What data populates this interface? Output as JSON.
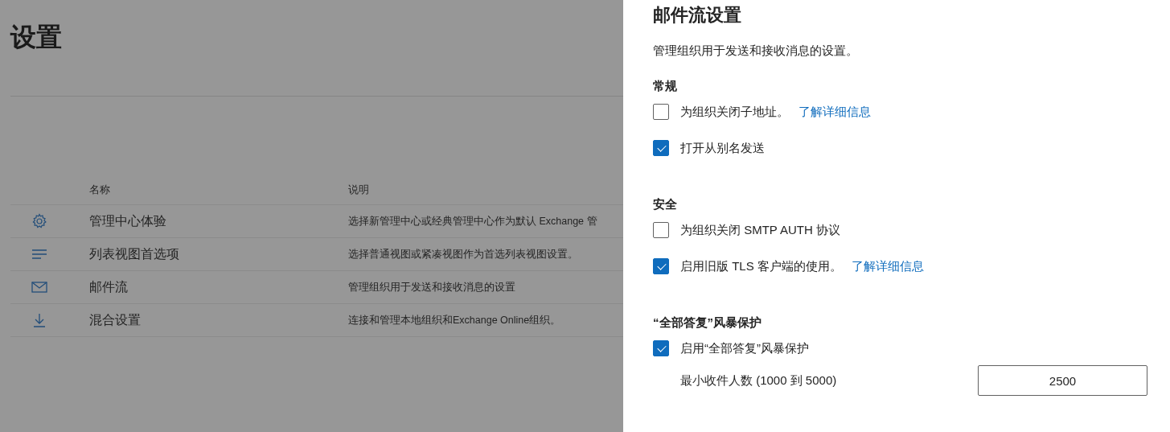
{
  "page": {
    "title": "设置",
    "table": {
      "columns": [
        "名称",
        "说明"
      ],
      "rows": [
        {
          "kind": "gear",
          "name": "管理中心体验",
          "description": "选择新管理中心或经典管理中心作为默认 Exchange 管"
        },
        {
          "kind": "list",
          "name": "列表视图首选项",
          "description": "选择普通视图或紧凑视图作为首选列表视图设置。"
        },
        {
          "kind": "mail",
          "name": "邮件流",
          "description": "管理组织用于发送和接收消息的设置"
        },
        {
          "kind": "download",
          "name": "混合设置",
          "description": "连接和管理本地组织和Exchange Online组织。"
        }
      ]
    }
  },
  "panel": {
    "title": "邮件流设置",
    "description": "管理组织用于发送和接收消息的设置。",
    "sections": [
      {
        "heading": "常规",
        "options": [
          {
            "label": "为组织关闭子地址。",
            "link": "了解详细信息",
            "checked": false
          },
          {
            "label": "打开从别名发送",
            "checked": true
          }
        ]
      },
      {
        "heading": "安全",
        "options": [
          {
            "label": "为组织关闭 SMTP AUTH 协议",
            "checked": false
          },
          {
            "label": "启用旧版 TLS 客户端的使用。",
            "link": "了解详细信息",
            "checked": true
          }
        ]
      },
      {
        "heading": "“全部答复”风暴保护",
        "options": [
          {
            "label": "启用“全部答复”风暴保护",
            "checked": true
          }
        ],
        "number_field": {
          "label": "最小收件人数 (1000 到 5000)",
          "value": "2500"
        }
      }
    ]
  }
}
